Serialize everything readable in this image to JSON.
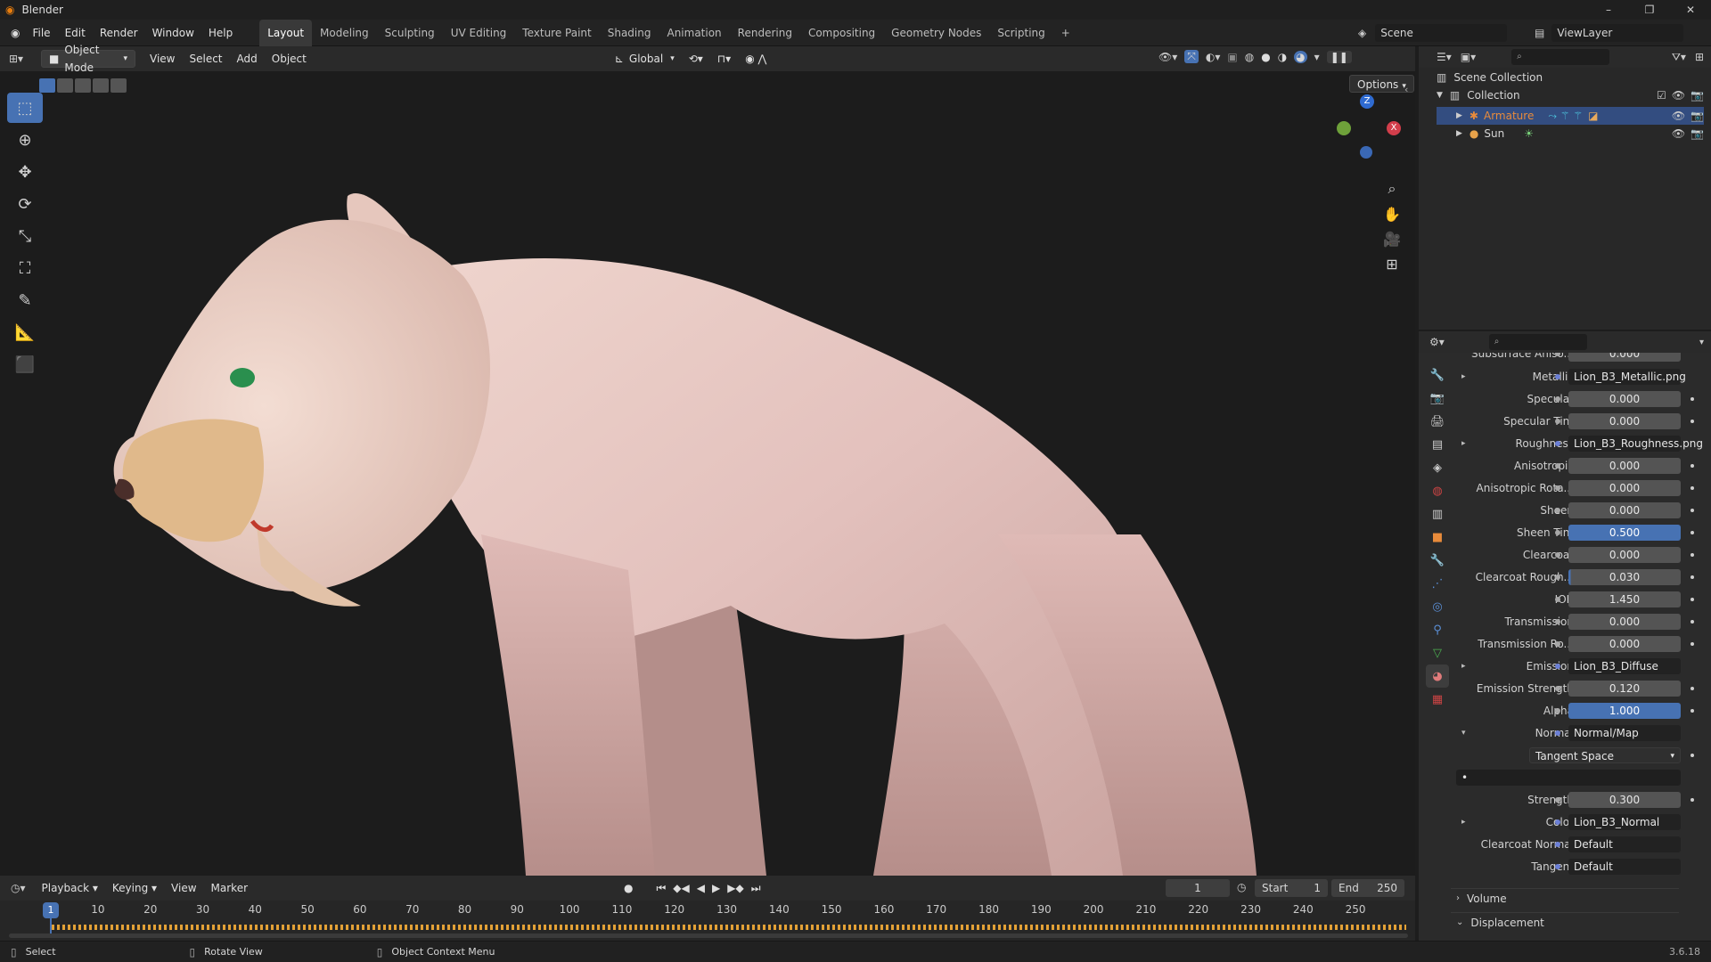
{
  "app": {
    "title": "Blender",
    "version": "3.6.18"
  },
  "menu": [
    "File",
    "Edit",
    "Render",
    "Window",
    "Help"
  ],
  "workspaces": [
    "Layout",
    "Modeling",
    "Sculpting",
    "UV Editing",
    "Texture Paint",
    "Shading",
    "Animation",
    "Rendering",
    "Compositing",
    "Geometry Nodes",
    "Scripting"
  ],
  "active_workspace": "Layout",
  "scene": {
    "label": "Scene",
    "view_layer": "ViewLayer"
  },
  "viewport_header": {
    "mode": "Object Mode",
    "menus": [
      "View",
      "Select",
      "Add",
      "Object"
    ],
    "orientation": "Global",
    "options": "Options"
  },
  "gizmo": {
    "z": "Z",
    "x": "X",
    "y": "Y"
  },
  "outliner": {
    "root": "Scene Collection",
    "collection": "Collection",
    "items": [
      {
        "name": "Armature",
        "color": "#e88b3b"
      },
      {
        "name": "Sun",
        "color": "#d0d0d0"
      }
    ]
  },
  "properties": {
    "cut_label": "Subsurface Aniso...",
    "cut_value": "0.000",
    "rows": [
      {
        "label": "Metallic",
        "value": "Lion_B3_Metallic.png",
        "kind": "tex",
        "expand": "▸"
      },
      {
        "label": "Specular",
        "value": "0.000",
        "kind": "num"
      },
      {
        "label": "Specular Tint",
        "value": "0.000",
        "kind": "num"
      },
      {
        "label": "Roughness",
        "value": "Lion_B3_Roughness.png",
        "kind": "tex",
        "expand": "▸"
      },
      {
        "label": "Anisotropic",
        "value": "0.000",
        "kind": "num"
      },
      {
        "label": "Anisotropic Rota...",
        "value": "0.000",
        "kind": "num"
      },
      {
        "label": "Sheen",
        "value": "0.000",
        "kind": "num"
      },
      {
        "label": "Sheen Tint",
        "value": "0.500",
        "kind": "blue"
      },
      {
        "label": "Clearcoat",
        "value": "0.000",
        "kind": "num"
      },
      {
        "label": "Clearcoat Rough...",
        "value": "0.030",
        "kind": "partial"
      },
      {
        "label": "IOR",
        "value": "1.450",
        "kind": "num"
      },
      {
        "label": "Transmission",
        "value": "0.000",
        "kind": "num"
      },
      {
        "label": "Transmission Ro...",
        "value": "0.000",
        "kind": "num"
      },
      {
        "label": "Emission",
        "value": "Lion_B3_Diffuse",
        "kind": "tex",
        "expand": "▸"
      },
      {
        "label": "Emission Strength",
        "value": "0.120",
        "kind": "num"
      },
      {
        "label": "Alpha",
        "value": "1.000",
        "kind": "blue"
      },
      {
        "label": "Normal",
        "value": "Normal/Map",
        "kind": "tex",
        "expand": "▾"
      },
      {
        "label": "",
        "value": "Tangent Space",
        "kind": "dropdown"
      },
      {
        "label": "",
        "value": "",
        "kind": "blank"
      },
      {
        "label": "Strength",
        "value": "0.300",
        "kind": "num"
      },
      {
        "label": "Color",
        "value": "Lion_B3_Normal",
        "kind": "tex",
        "expand": "▸"
      },
      {
        "label": "Clearcoat Normal",
        "value": "Default",
        "kind": "tex"
      },
      {
        "label": "Tangent",
        "value": "Default",
        "kind": "tex"
      }
    ],
    "panels": [
      "Volume",
      "Displacement"
    ]
  },
  "timeline": {
    "menus": [
      "Playback",
      "Keying",
      "View",
      "Marker"
    ],
    "current_frame": "1",
    "start_label": "Start",
    "start": "1",
    "end_label": "End",
    "end": "250",
    "ticks": [
      "10",
      "20",
      "30",
      "40",
      "50",
      "60",
      "70",
      "80",
      "90",
      "100",
      "110",
      "120",
      "130",
      "140",
      "150",
      "160",
      "170",
      "180",
      "190",
      "200",
      "210",
      "220",
      "230",
      "240",
      "250"
    ],
    "frame_marker": "1"
  },
  "status": {
    "select": "Select",
    "rotate": "Rotate View",
    "context": "Object Context Menu"
  }
}
